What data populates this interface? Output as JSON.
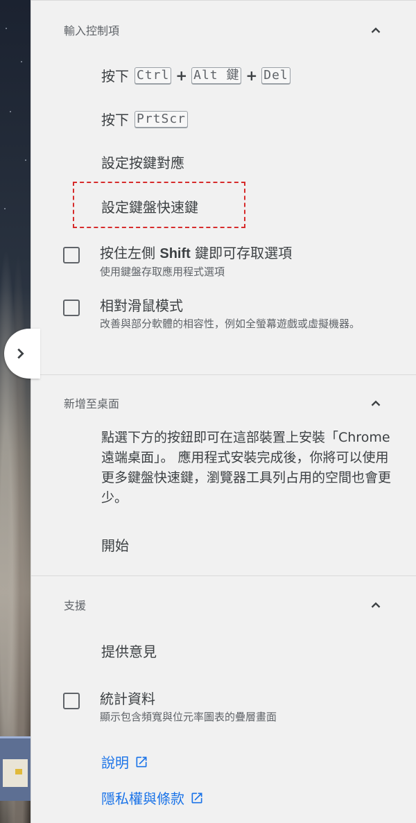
{
  "input_controls": {
    "title": "輸入控制項",
    "press_label": "按下",
    "ctrl_alt_del": {
      "key1": "Ctrl",
      "key2": "Alt 鍵",
      "key3": "Del",
      "plus": "+"
    },
    "prtscr_key": "PrtScr",
    "key_mapping": "設定按鍵對應",
    "keyboard_shortcuts": "設定鍵盤快速鍵",
    "shift_option": {
      "title_pre": "按住左側",
      "title_bold": "Shift",
      "title_post": "鍵即可存取選項",
      "subtitle": "使用鍵盤存取應用程式選項"
    },
    "relative_mouse": {
      "title": "相對滑鼠模式",
      "subtitle": "改善與部分軟體的相容性，例如全螢幕遊戲或虛擬機器。"
    }
  },
  "add_to_desktop": {
    "title": "新增至桌面",
    "description": "點選下方的按鈕即可在這部裝置上安裝「Chrome 遠端桌面」。 應用程式安裝完成後，你將可以使用更多鍵盤快速鍵，瀏覽器工具列占用的空間也會更少。",
    "start_label": "開始"
  },
  "support": {
    "title": "支援",
    "feedback": "提供意見",
    "stats": {
      "title": "統計資料",
      "subtitle": "顯示包含頻寬與位元率圖表的疊層畫面"
    },
    "help_link": "說明",
    "privacy_link": "隱私權與條款"
  },
  "colors": {
    "link": "#1a73e8",
    "highlight_dashed": "#d62b2b",
    "panel_bg": "#f1f1f1"
  },
  "icons": [
    "chevron-right-icon",
    "chevron-up-icon",
    "external-link-icon"
  ]
}
